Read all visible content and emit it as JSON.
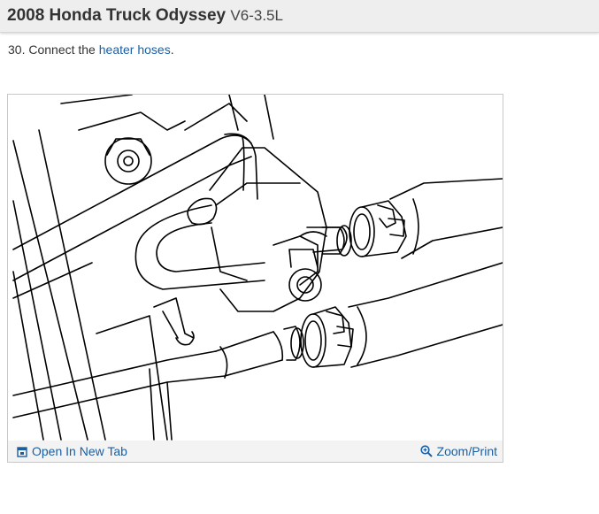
{
  "header": {
    "title": "2008 Honda Truck Odyssey",
    "engine": "V6-3.5L"
  },
  "step": {
    "number_text": "30. Connect the ",
    "link_text": "heater hoses",
    "suffix": "."
  },
  "figure": {
    "open_label": "Open In New Tab",
    "zoom_label": "Zoom/Print",
    "open_icon": "open-tab-icon",
    "zoom_icon": "magnifier-icon"
  },
  "colors": {
    "link": "#1b5fa3",
    "header_bg": "#eeeeee"
  }
}
